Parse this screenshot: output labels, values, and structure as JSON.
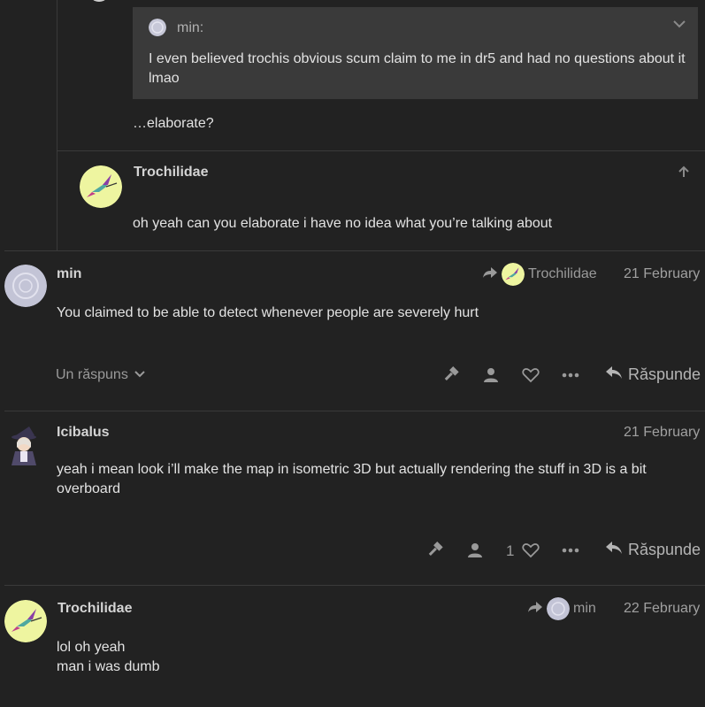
{
  "quote": {
    "author": "min:",
    "text": "I even believed trochis obvious scum claim to me in dr5 and had no questions about it lmao"
  },
  "nested_post_text": "…elaborate?",
  "nested_reply": {
    "author": "Trochilidae",
    "text": "oh yeah can you elaborate i have no idea what you’re talking about"
  },
  "posts": [
    {
      "author": "min",
      "reply_to": "Trochilidae",
      "date": "21 February",
      "text": "You claimed to be able to detect whenever people are severely hurt",
      "replies_label": "Un răspuns",
      "reply_label": "Răspunde"
    },
    {
      "author": "Icibalus",
      "date": "21 February",
      "text": "yeah i mean look i’ll make the map in isometric 3D but actually rendering the stuff in 3D is a bit overboard",
      "likes": "1",
      "reply_label": "Răspunde"
    },
    {
      "author": "Trochilidae",
      "reply_to": "min",
      "date": "22 February",
      "text_line1": "lol oh yeah",
      "text_line2": "man i was dumb"
    }
  ]
}
